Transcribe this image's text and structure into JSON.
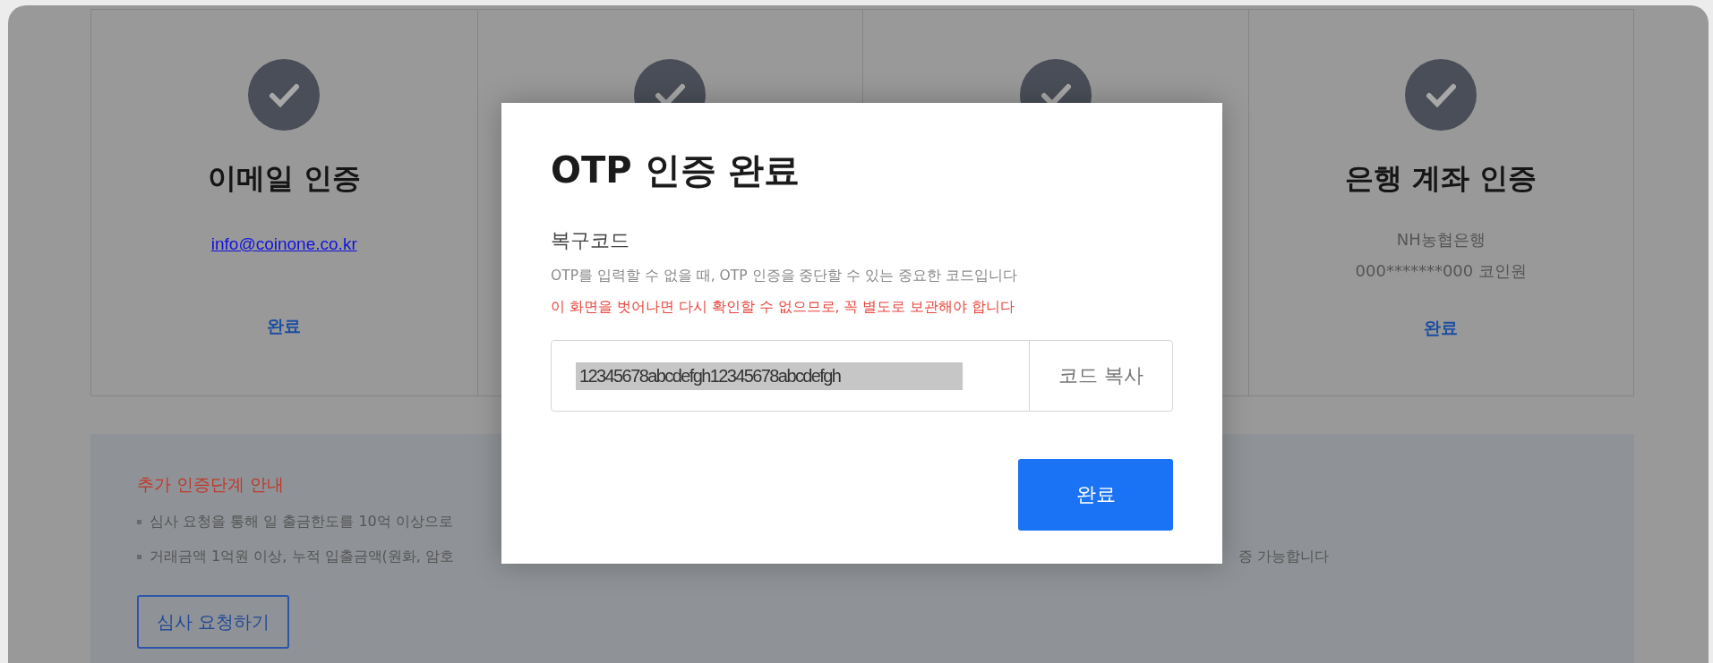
{
  "cards": [
    {
      "kind": "email",
      "title": "이메일 인증",
      "email": "info@coinone.co.kr",
      "status": "완료"
    },
    {
      "kind": "covered"
    },
    {
      "kind": "covered"
    },
    {
      "kind": "bank",
      "title": "은행 계좌 인증",
      "lines": [
        "NH농협은행",
        "000*******000 코인원"
      ],
      "status": "완료"
    }
  ],
  "notice": {
    "title": "추가 인증단계 안내",
    "bullets": [
      {
        "text": "심사 요청을 통해 일 출금한도를 10억 이상으로"
      },
      {
        "text": "거래금액 1억원 이상, 누적 입출금액(원화, 암호",
        "tail": "증 가능합니다"
      }
    ],
    "button": "심사 요청하기"
  },
  "modal": {
    "title": "OTP 인증 완료",
    "label": "복구코드",
    "description": "OTP를 입력할 수 없을 때, OTP 인증을 중단할 수 있는 중요한 코드입니다",
    "warning": "이 화면을 벗어나면 다시 확인할 수 없으므로, 꼭 별도로 보관해야 합니다",
    "code": "12345678abcdefgh12345678abcdefgh",
    "copy_button": "코드 복사",
    "confirm_button": "완료"
  }
}
